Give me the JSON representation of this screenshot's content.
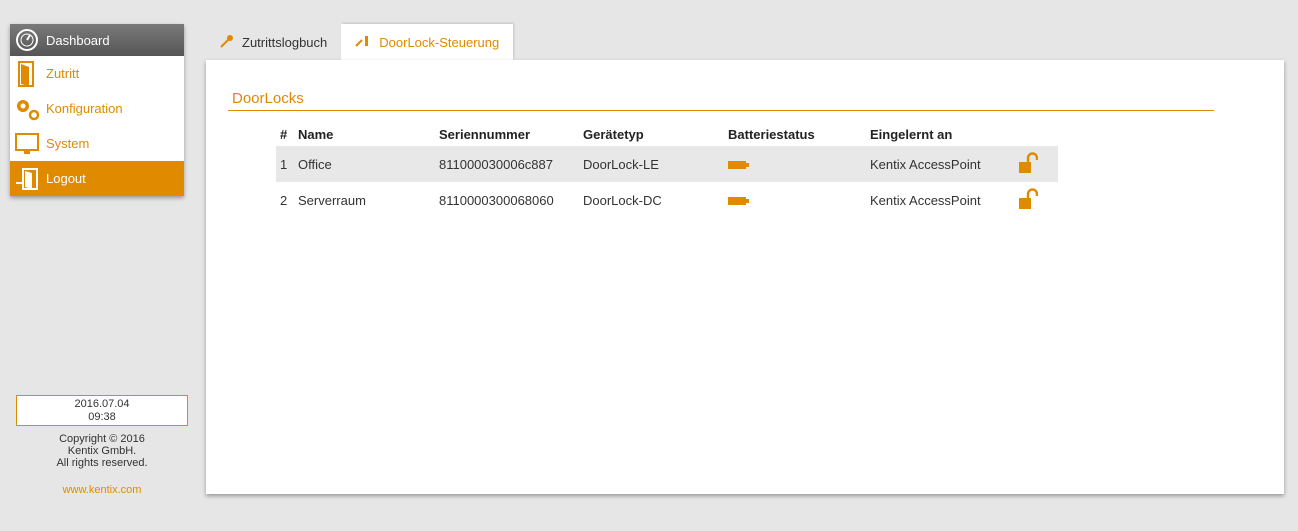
{
  "sidebar": {
    "items": [
      {
        "label": "Dashboard",
        "icon": "gauge-icon"
      },
      {
        "label": "Zutritt",
        "icon": "door-icon"
      },
      {
        "label": "Konfiguration",
        "icon": "gears-icon"
      },
      {
        "label": "System",
        "icon": "monitor-icon"
      },
      {
        "label": "Logout",
        "icon": "logout-icon"
      }
    ],
    "date": "2016.07.04",
    "time": "09:38",
    "copyright_line1": "Copyright © 2016",
    "copyright_line2": "Kentix GmbH.",
    "copyright_line3": "All rights reserved.",
    "website": "www.kentix.com"
  },
  "tabs": [
    {
      "label": "Zutrittslogbuch",
      "icon": "key-icon"
    },
    {
      "label": "DoorLock-Steuerung",
      "icon": "wrench-icon"
    }
  ],
  "main": {
    "section_title": "DoorLocks",
    "columns": [
      "#",
      "Name",
      "Seriennummer",
      "Gerätetyp",
      "Batteriestatus",
      "Eingelernt an"
    ],
    "rows": [
      {
        "num": "1",
        "name": "Office",
        "serial": "811000030006c887",
        "type": "DoorLock-LE",
        "battery": "battery-icon",
        "paired": "Kentix AccessPoint",
        "lock": "unlock-icon"
      },
      {
        "num": "2",
        "name": "Serverraum",
        "serial": "8110000300068060",
        "type": "DoorLock-DC",
        "battery": "battery-icon",
        "paired": "Kentix AccessPoint",
        "lock": "unlock-icon"
      }
    ]
  },
  "colors": {
    "accent": "#e08a00",
    "background": "#e6e6e6",
    "dashboard_bg": "#666666"
  }
}
